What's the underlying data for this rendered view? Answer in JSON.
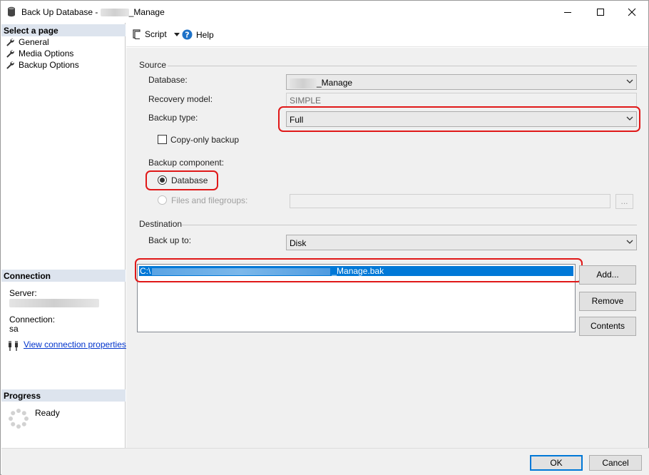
{
  "window": {
    "title_prefix": "Back Up Database - ",
    "title_suffix": "_Manage",
    "controls": [
      "minimize",
      "maximize",
      "close"
    ]
  },
  "left_pane": {
    "select_page_header": "Select a page",
    "pages": [
      {
        "label": "General",
        "icon": "wrench-icon"
      },
      {
        "label": "Media Options",
        "icon": "wrench-icon"
      },
      {
        "label": "Backup Options",
        "icon": "wrench-icon"
      }
    ],
    "connection_header": "Connection",
    "server_label": "Server:",
    "connection_label": "Connection:",
    "connection_value": "sa",
    "view_connection_link": "View connection properties",
    "progress_header": "Progress",
    "progress_status": "Ready"
  },
  "toolbar": {
    "script_label": "Script",
    "help_label": "Help"
  },
  "source": {
    "group_label": "Source",
    "database_label": "Database:",
    "database_value_suffix": "_Manage",
    "recovery_model_label": "Recovery model:",
    "recovery_model_value": "SIMPLE",
    "backup_type_label": "Backup type:",
    "backup_type_value": "Full",
    "copy_only_label": "Copy-only backup",
    "copy_only_checked": false,
    "backup_component_label": "Backup component:",
    "component_database_label": "Database",
    "component_files_label": "Files and filegroups:",
    "ellipsis_label": "..."
  },
  "destination": {
    "group_label": "Destination",
    "back_up_to_label": "Back up to:",
    "back_up_to_value": "Disk",
    "path_prefix": "C:\\",
    "path_suffix": "_Manage.bak",
    "add_label": "Add...",
    "remove_label": "Remove",
    "contents_label": "Contents"
  },
  "footer": {
    "ok_label": "OK",
    "cancel_label": "Cancel"
  },
  "colors": {
    "highlight_ring": "#e01818",
    "selection": "#0078d7",
    "section_header": "#dde4ee",
    "link": "#0033cc"
  }
}
